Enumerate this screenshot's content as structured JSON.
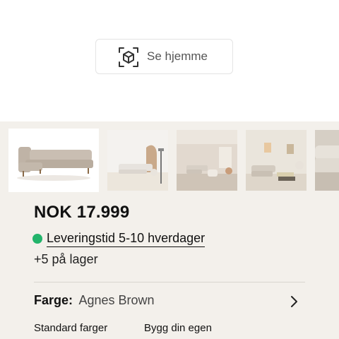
{
  "ar_button": {
    "label": "Se hjemme",
    "icon": "ar-cube-icon"
  },
  "gallery": {
    "thumbnails": [
      {
        "name": "sofa-product-photo",
        "active": true
      },
      {
        "name": "sofa-living-room-lamp",
        "active": false
      },
      {
        "name": "sofa-room-beige",
        "active": false
      },
      {
        "name": "sofa-room-pictures",
        "active": false
      },
      {
        "name": "sofa-closeup-partial",
        "active": false
      }
    ]
  },
  "product": {
    "price": "NOK 17.999",
    "delivery": {
      "text": "Leveringstid 5-10 hverdager",
      "status_color": "#22b46b"
    },
    "stock": "+5 på lager"
  },
  "color_selector": {
    "key": "Farge:",
    "value": "Agnes Brown",
    "icon": "chevron-right-icon"
  },
  "color_options": {
    "standard": "Standard farger",
    "custom": "Bygg din egen"
  },
  "colors": {
    "background_panel": "#f3f0eb",
    "accent_green": "#22b46b"
  }
}
